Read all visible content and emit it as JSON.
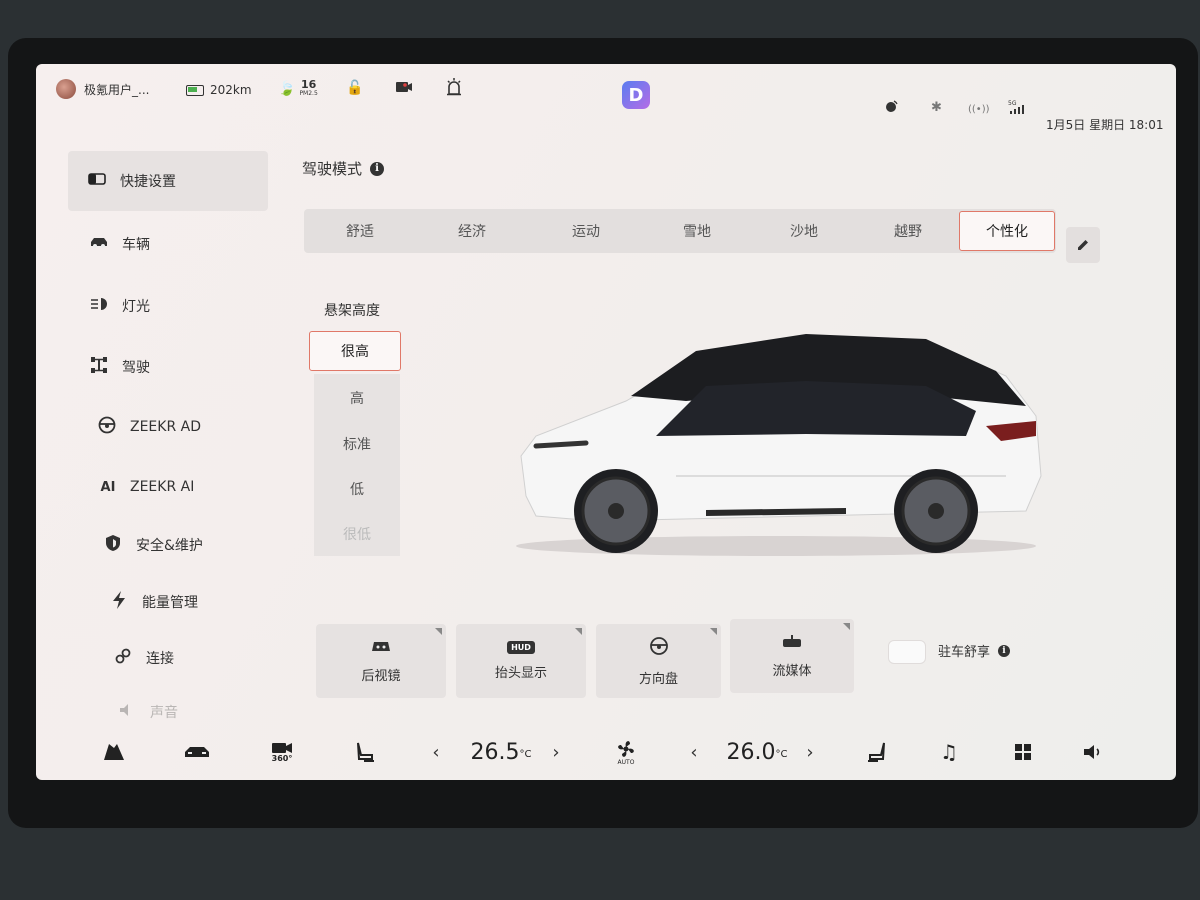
{
  "status_bar": {
    "user_name": "极氪用户_...",
    "range": "202km",
    "pm25_value": "16",
    "pm25_label": "PM2.5",
    "datetime": "1月5日 星期日 18:01"
  },
  "sidebar": {
    "items": [
      {
        "label": "快捷设置",
        "icon": "quick-settings-icon"
      },
      {
        "label": "车辆",
        "icon": "car-icon"
      },
      {
        "label": "灯光",
        "icon": "headlight-icon"
      },
      {
        "label": "驾驶",
        "icon": "chassis-icon"
      },
      {
        "label": "ZEEKR AD",
        "icon": "steering-wheel-icon"
      },
      {
        "label": "ZEEKR AI",
        "icon": "ai-icon",
        "icon_text": "AI"
      },
      {
        "label": "安全&维护",
        "icon": "shield-icon"
      },
      {
        "label": "能量管理",
        "icon": "lightning-icon"
      },
      {
        "label": "连接",
        "icon": "link-icon"
      },
      {
        "label": "声音",
        "icon": "speaker-icon"
      }
    ]
  },
  "drive_mode": {
    "title": "驾驶模式",
    "modes": [
      "舒适",
      "经济",
      "运动",
      "雪地",
      "沙地",
      "越野",
      "个性化"
    ],
    "selected": "个性化"
  },
  "suspension": {
    "title": "悬架高度",
    "options": [
      "很高",
      "高",
      "标准",
      "低",
      "很低"
    ],
    "selected": "很高"
  },
  "quick_buttons": [
    {
      "label": "后视镜",
      "icon": "mirror-icon"
    },
    {
      "label": "抬头显示",
      "icon": "hud-icon",
      "icon_text": "HUD"
    },
    {
      "label": "方向盘",
      "icon": "steering-wheel-icon"
    },
    {
      "label": "流媒体",
      "icon": "streaming-mirror-icon"
    }
  ],
  "parking_comfort": {
    "label": "驻车舒享",
    "enabled": false
  },
  "climate": {
    "driver_temp": "26.5",
    "passenger_temp": "26.0",
    "unit": "°C",
    "fan_label": "AUTO"
  },
  "bottom_bar": {
    "camera_label": "360°"
  },
  "colors": {
    "accent": "#e07868",
    "background": "#f3eeed",
    "panel": "#e3dfde"
  }
}
